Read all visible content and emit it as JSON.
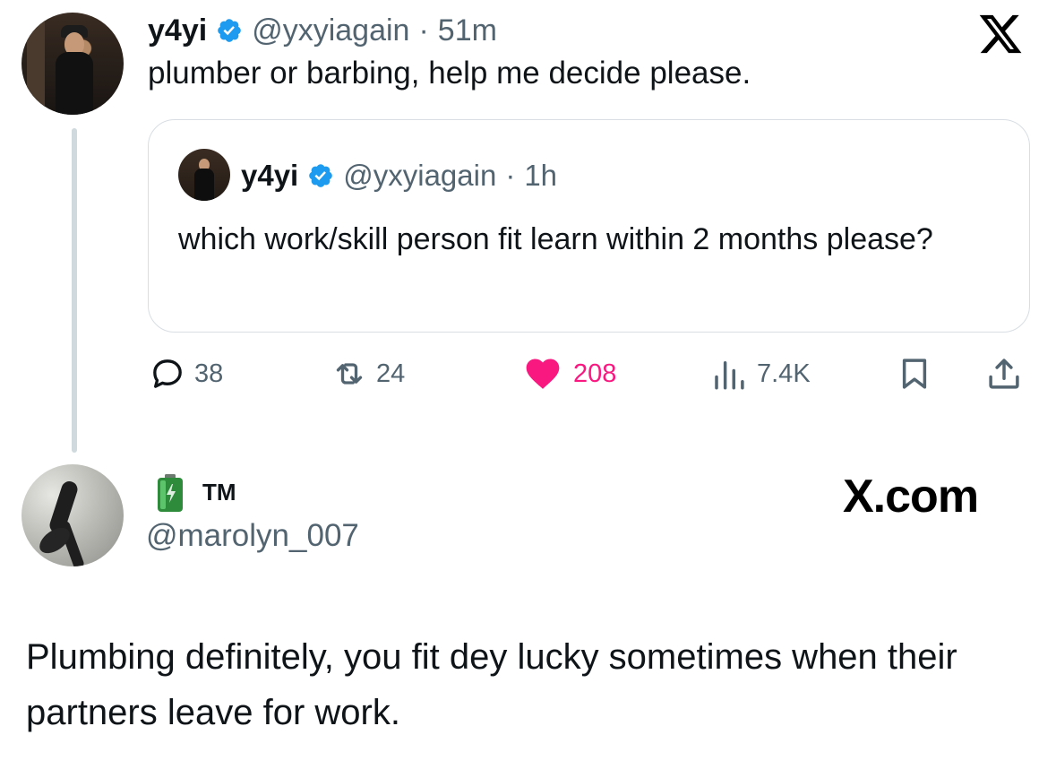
{
  "main_tweet": {
    "name": "y4yi",
    "handle": "@yxyiagain",
    "separator": "·",
    "time": "51m",
    "text": "plumber or barbing, help me decide please."
  },
  "quoted_tweet": {
    "name": "y4yi",
    "handle": "@yxyiagain",
    "separator": "·",
    "time": "1h",
    "text": "which work/skill person fit learn within 2 months please?"
  },
  "actions": {
    "replies": "38",
    "reposts": "24",
    "likes": "208",
    "views": "7.4K"
  },
  "reply": {
    "name": "TM",
    "handle": "@marolyn_007",
    "watermark": "X.com",
    "text": "Plumbing definitely, you fit dey lucky sometimes when their partners leave for work."
  },
  "icons": {
    "verified": "verified-badge-icon",
    "brand": "x-logo-icon",
    "battery": "battery-emoji-icon",
    "reply": "reply-icon",
    "repost": "repost-icon",
    "like": "heart-icon",
    "views": "views-icon",
    "bookmark": "bookmark-icon",
    "share": "share-icon"
  },
  "colors": {
    "verified_blue": "#1d9bf0",
    "like_pink": "#f91880",
    "muted_text": "#536471",
    "text": "#0f1419"
  }
}
